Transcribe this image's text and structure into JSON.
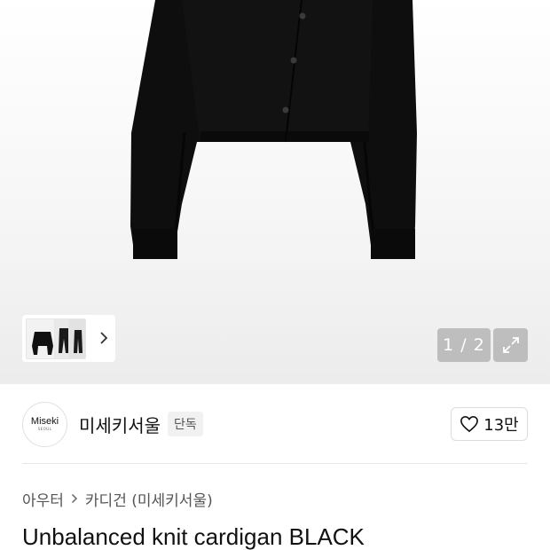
{
  "gallery": {
    "pager_text": "1 / 2",
    "icons": {
      "next": "chevron-right-icon",
      "expand": "expand-icon"
    }
  },
  "brand": {
    "logo_text": "Miseki",
    "logo_subtext": "SEOUL",
    "name": "미세키서울",
    "badge": "단독",
    "likes": "13만",
    "like_icon": "heart-icon"
  },
  "breadcrumb": {
    "items": [
      "아우터",
      "카디건 (미세키서울)"
    ],
    "separator_icon": "chevron-right-icon"
  },
  "product": {
    "title": "Unbalanced knit cardigan BLACK"
  },
  "colors": {
    "garment": "#0d0d0d",
    "pager_bg": "#969696"
  }
}
